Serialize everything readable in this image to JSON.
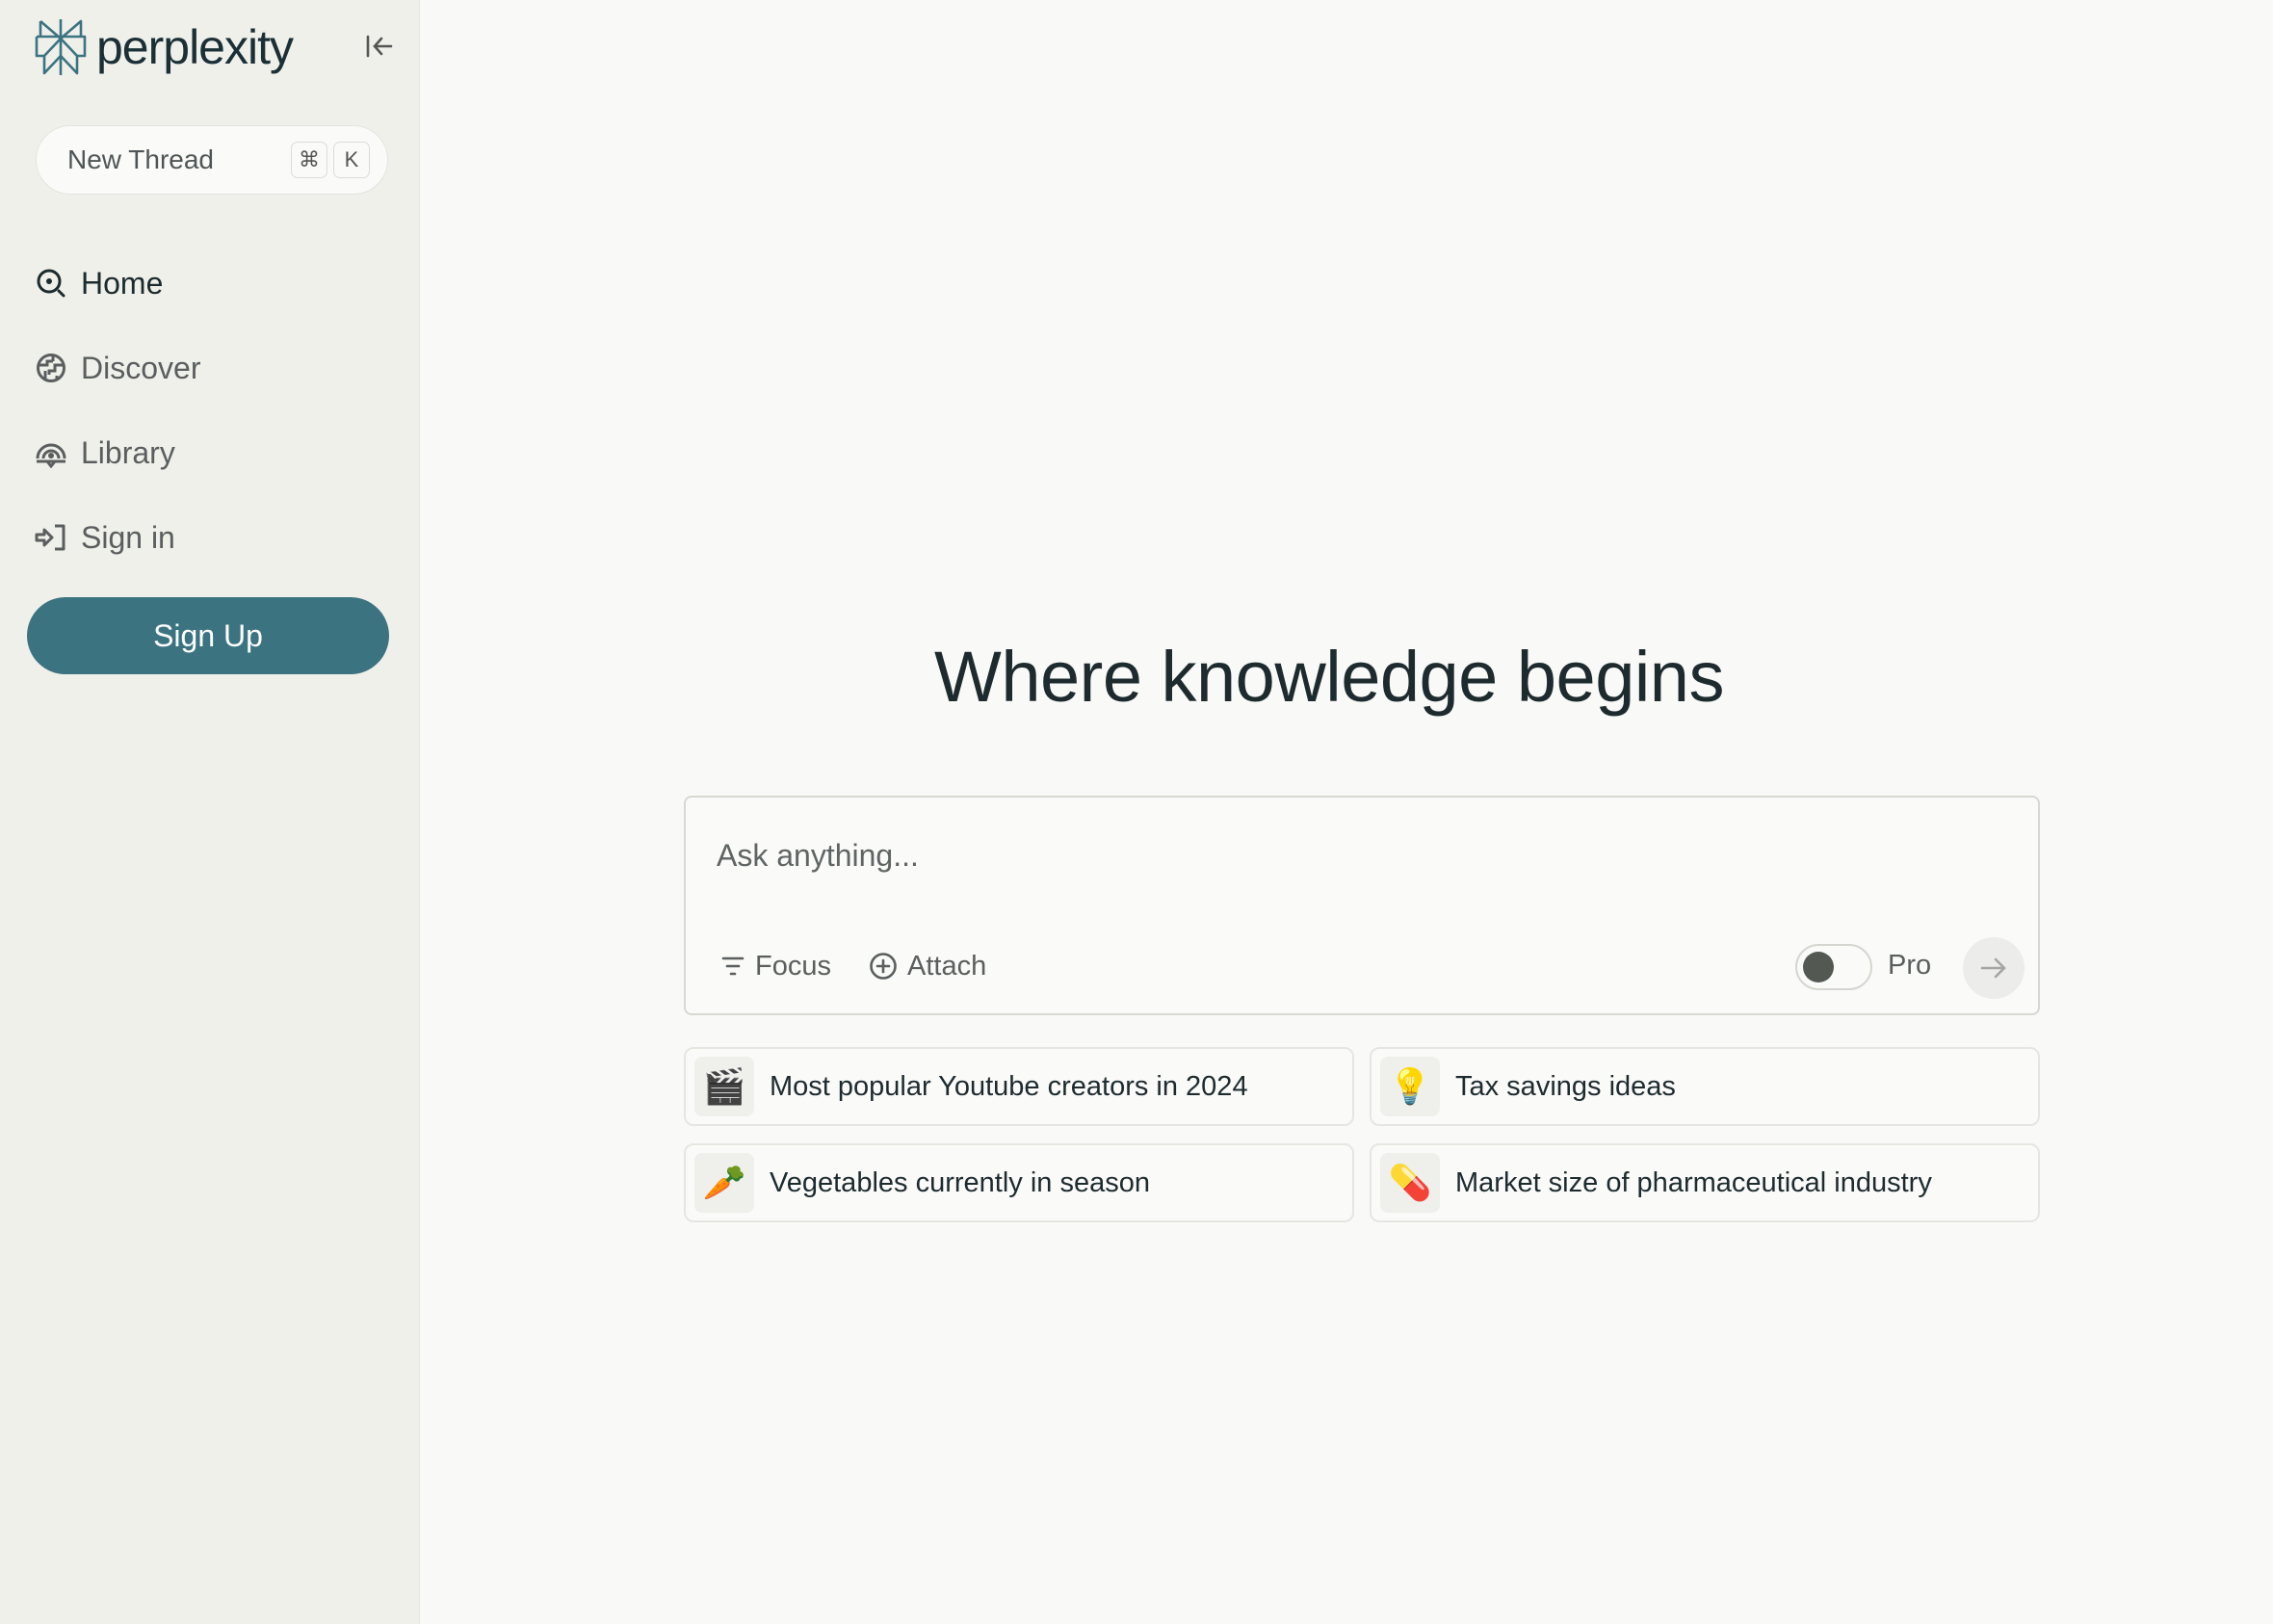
{
  "app": {
    "brand_name": "perplexity",
    "brand_color": "#3b7380"
  },
  "sidebar": {
    "collapse_icon": "collapse-left-icon",
    "new_thread": {
      "label": "New Thread",
      "shortcut_keys": [
        "⌘",
        "K"
      ]
    },
    "nav_items": [
      {
        "label": "Home",
        "icon": "search-circle-icon",
        "active": true
      },
      {
        "label": "Discover",
        "icon": "globe-icon",
        "active": false
      },
      {
        "label": "Library",
        "icon": "library-icon",
        "active": false
      },
      {
        "label": "Sign in",
        "icon": "sign-in-icon",
        "active": false
      }
    ],
    "signup_label": "Sign Up"
  },
  "main": {
    "heading": "Where knowledge begins",
    "search": {
      "placeholder": "Ask anything...",
      "value": "",
      "focus_label": "Focus",
      "attach_label": "Attach",
      "pro_label": "Pro",
      "pro_enabled": false,
      "submit_icon": "arrow-right-icon"
    },
    "suggestions": [
      {
        "emoji": "🎬",
        "label": "Most popular Youtube creators in 2024"
      },
      {
        "emoji": "💡",
        "label": "Tax savings ideas"
      },
      {
        "emoji": "🥕",
        "label": "Vegetables currently in season"
      },
      {
        "emoji": "💊",
        "label": "Market size of pharmaceutical industry"
      }
    ]
  }
}
